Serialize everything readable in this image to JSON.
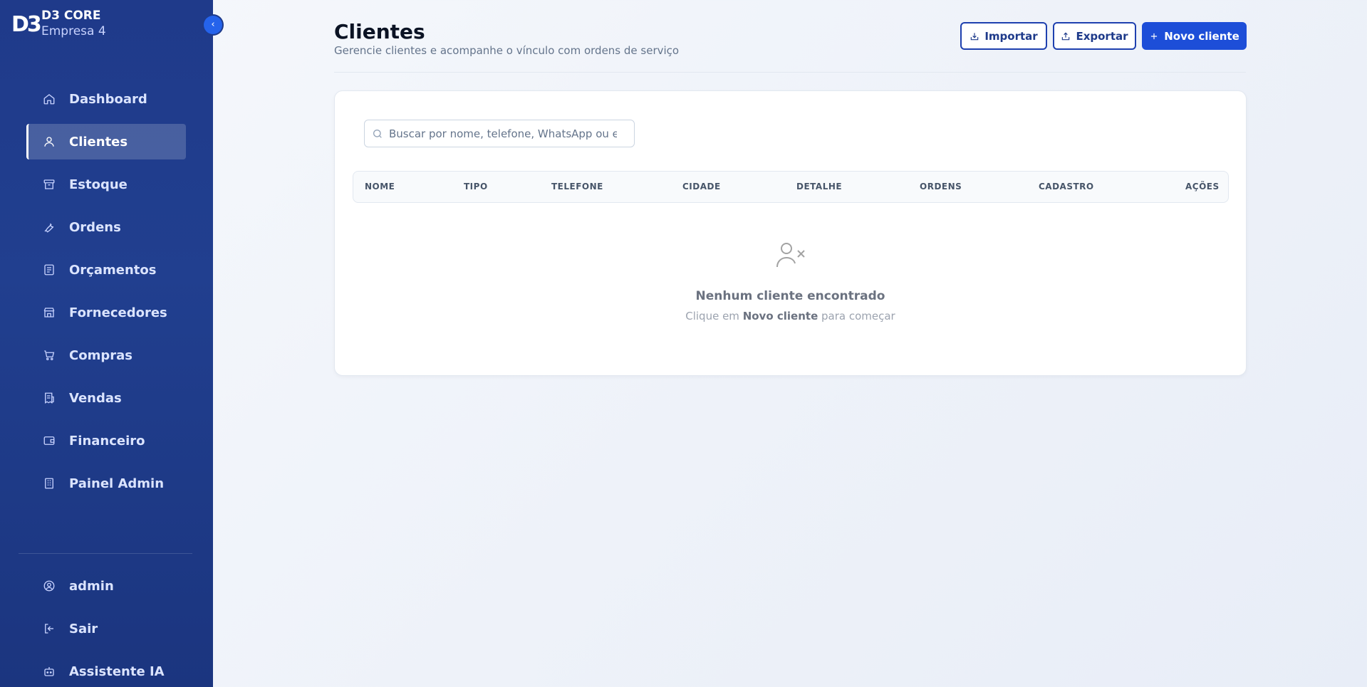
{
  "brand": {
    "logo": "D3",
    "name": "D3 CORE",
    "company": "Empresa 4"
  },
  "sidebar": {
    "collapse_label": "‹",
    "items": [
      {
        "label": "Dashboard",
        "icon": "home-icon"
      },
      {
        "label": "Clientes",
        "icon": "user-icon",
        "active": true
      },
      {
        "label": "Estoque",
        "icon": "archive-icon"
      },
      {
        "label": "Ordens",
        "icon": "wrench-icon"
      },
      {
        "label": "Orçamentos",
        "icon": "list-icon"
      },
      {
        "label": "Fornecedores",
        "icon": "store-icon"
      },
      {
        "label": "Compras",
        "icon": "cart-icon"
      },
      {
        "label": "Vendas",
        "icon": "receipt-icon"
      },
      {
        "label": "Financeiro",
        "icon": "wallet-icon"
      },
      {
        "label": "Painel Admin",
        "icon": "building-icon"
      }
    ],
    "bottom": [
      {
        "label": "admin",
        "icon": "user-circle-icon"
      },
      {
        "label": "Sair",
        "icon": "logout-icon"
      },
      {
        "label": "Assistente IA",
        "icon": "bot-icon"
      }
    ]
  },
  "header": {
    "title": "Clientes",
    "subtitle": "Gerencie clientes e acompanhe o vínculo com ordens de serviço",
    "import_label": "Importar",
    "export_label": "Exportar",
    "new_label": "Novo cliente"
  },
  "search": {
    "placeholder": "Buscar por nome, telefone, WhatsApp ou e-mail"
  },
  "table": {
    "columns": [
      "NOME",
      "TIPO",
      "TELEFONE",
      "CIDADE",
      "DETALHE",
      "ORDENS",
      "CADASTRO",
      "AÇÕES"
    ]
  },
  "empty": {
    "title": "Nenhum cliente encontrado",
    "hint_prefix": "Clique em ",
    "hint_bold": "Novo cliente",
    "hint_suffix": " para começar"
  },
  "colors": {
    "sidebar": "#1f3a8a",
    "primary": "#1d4ed8",
    "active_bg": "#4a64a8"
  }
}
